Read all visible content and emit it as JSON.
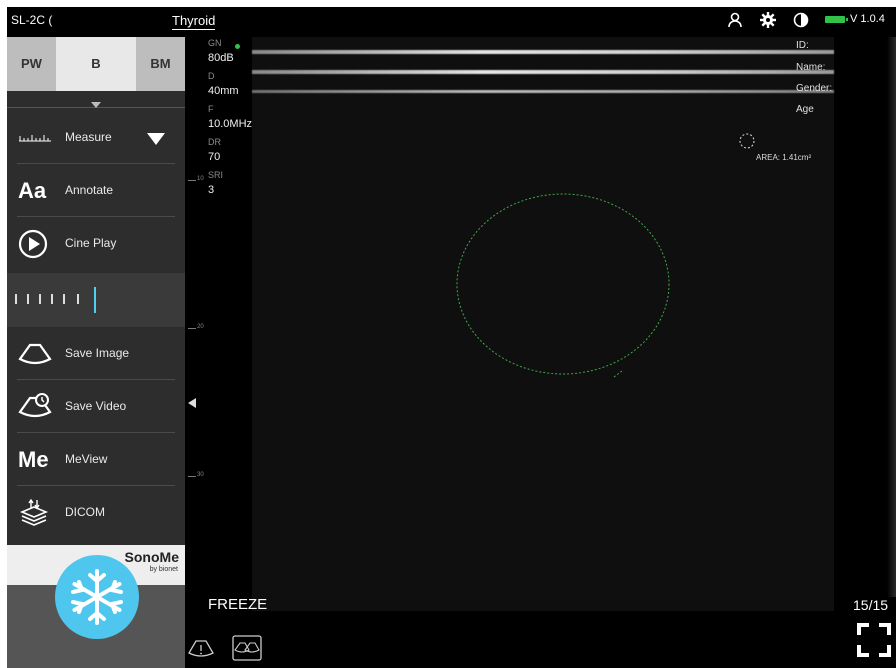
{
  "status_bar": {
    "probe": "SL-2C (",
    "preset": "Thyroid",
    "version": "V 1.0.4",
    "icons": [
      "user-icon",
      "gear-icon",
      "contrast-icon",
      "battery-icon"
    ],
    "battery_color": "#31c24a"
  },
  "sidebar": {
    "modes": {
      "pw": "PW",
      "b": "B",
      "bm": "BM",
      "selected": "B"
    },
    "tools": {
      "measure": "Measure",
      "annotate": "Annotate",
      "annotate_icon_text": "Aa",
      "cine": "Cine Play",
      "save_image": "Save Image",
      "save_video": "Save Video",
      "meview": "MeView",
      "meview_icon_text": "Me",
      "dicom": "DICOM"
    },
    "brand": {
      "name": "SonoMe",
      "sub": "by bionet"
    },
    "freeze_icon": "snowflake-icon",
    "accent": "#4fc6ee"
  },
  "params": {
    "gn_label": "GN",
    "gn_value": "80dB",
    "d_label": "D",
    "d_value": "40mm",
    "f_label": "F",
    "f_value": "10.0MHz",
    "dr_label": "DR",
    "dr_value": "70",
    "sri_label": "SRI",
    "sri_value": "3"
  },
  "ruler": {
    "marks": [
      "10",
      "20",
      "30"
    ]
  },
  "patient": {
    "id": "ID:",
    "name": "Name:",
    "gender": "Gender:",
    "age": "Age"
  },
  "measurement": {
    "area": "AREA: 1.41cm²",
    "roi_color": "#3fa84a"
  },
  "footer": {
    "freeze": "FREEZE",
    "frame": "15/15"
  }
}
